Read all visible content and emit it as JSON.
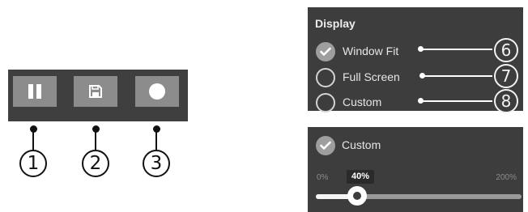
{
  "toolbar": {
    "buttons": [
      {
        "icon": "pause-icon",
        "callout": "1"
      },
      {
        "icon": "save-icon",
        "callout": "2"
      },
      {
        "icon": "record-icon",
        "callout": "3"
      }
    ]
  },
  "display": {
    "title": "Display",
    "options": [
      {
        "label": "Window Fit",
        "checked": true,
        "callout": "6"
      },
      {
        "label": "Full Screen",
        "checked": false,
        "callout": "7"
      },
      {
        "label": "Custom",
        "checked": false,
        "callout": "8"
      }
    ]
  },
  "custom": {
    "label": "Custom",
    "checked": true,
    "slider": {
      "min_label": "0%",
      "max_label": "200%",
      "value_label": "40%",
      "value": 40,
      "min": 0,
      "max": 200
    }
  },
  "colors": {
    "panel": "#3d3d3d",
    "button": "#8c8c8c",
    "text": "#e6e6e6"
  }
}
